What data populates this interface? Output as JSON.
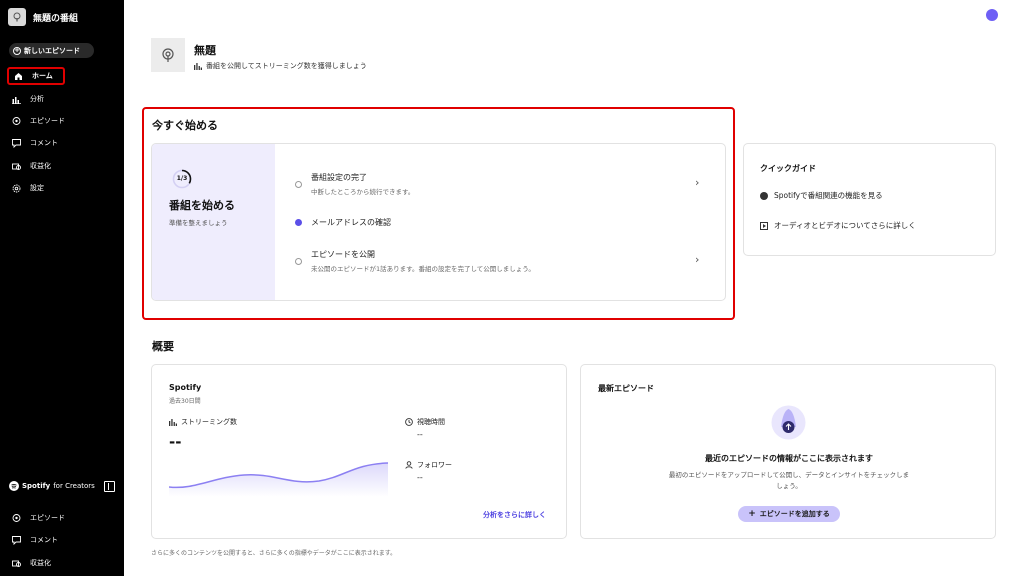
{
  "sidebar": {
    "show_name": "無題の番組",
    "new_episode_label": "新しいエピソード",
    "items": [
      {
        "label": "ホーム",
        "icon": "home-icon",
        "active": true
      },
      {
        "label": "分析",
        "icon": "analytics-icon",
        "active": false
      },
      {
        "label": "エピソード",
        "icon": "podcast-icon",
        "active": false
      },
      {
        "label": "コメント",
        "icon": "comment-icon",
        "active": false
      },
      {
        "label": "収益化",
        "icon": "monetize-icon",
        "active": false
      },
      {
        "label": "設定",
        "icon": "gear-icon",
        "active": false
      }
    ],
    "brand": {
      "name": "Spotify",
      "suffix": "for Creators"
    },
    "bottom_items": [
      {
        "label": "エピソード",
        "icon": "podcast-icon"
      },
      {
        "label": "コメント",
        "icon": "comment-icon"
      },
      {
        "label": "収益化",
        "icon": "monetize-icon"
      }
    ]
  },
  "header": {
    "title": "無題",
    "subtitle": "番組を公開してストリーミング数を獲得しましょう"
  },
  "get_started": {
    "title": "今すぐ始める",
    "progress": "1/3",
    "progress_fraction": 0.333,
    "heading": "番組を始める",
    "subheading": "準備を整えましょう",
    "tasks": [
      {
        "title": "番組設定の完了",
        "desc": "中断したところから続行できます。",
        "done": false
      },
      {
        "title": "メールアドレスの確認",
        "desc": "",
        "done": true
      },
      {
        "title": "エピソードを公開",
        "desc": "未公開のエピソードが1話あります。番組の設定を完了して公開しましょう。",
        "done": false
      }
    ]
  },
  "quick_guide": {
    "title": "クイックガイド",
    "items": [
      {
        "label": "Spotifyで番組関連の機能を見る",
        "icon": "spotify-icon"
      },
      {
        "label": "オーディオとビデオについてさらに詳しく",
        "icon": "play-icon"
      }
    ]
  },
  "overview": {
    "title": "概要",
    "spotify": {
      "name": "Spotify",
      "period": "過去30日間",
      "streams_label": "ストリーミング数",
      "streams_value": "--",
      "listen_time_label": "視聴時間",
      "listen_time_value": "--",
      "followers_label": "フォロワー",
      "followers_value": "--",
      "more_link": "分析をさらに詳しく"
    },
    "latest_episode": {
      "title": "最新エピソード",
      "heading": "最近のエピソードの情報がここに表示されます",
      "desc": "最初のエピソードをアップロードして公開し、データとインサイトをチェックしましょう。",
      "button": "エピソードを追加する"
    },
    "footnote": "さらに多くのコンテンツを公開すると、さらに多くの指標やデータがここに表示されます。"
  },
  "colors": {
    "accent": "#6e5ff5",
    "highlight": "#e00000",
    "card_tint": "#efedfd"
  }
}
